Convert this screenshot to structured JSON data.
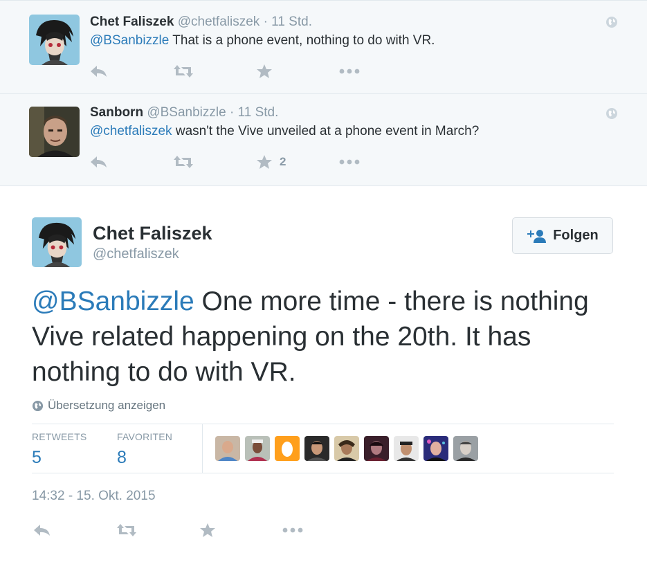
{
  "replies": [
    {
      "name": "Chet Faliszek",
      "handle": "@chetfaliszek",
      "separator": "·",
      "time": "11 Std.",
      "mention": "@BSanbizzle",
      "text": " That is a  phone event, nothing to do with VR.",
      "fav_count": ""
    },
    {
      "name": "Sanborn",
      "handle": "@BSanbizzle",
      "separator": "·",
      "time": "11 Std.",
      "mention": "@chetfaliszek",
      "text": " wasn't the Vive unveiled at a phone event in March?",
      "fav_count": "2"
    }
  ],
  "main": {
    "name": "Chet Faliszek",
    "handle": "@chetfaliszek",
    "follow_label": "Folgen",
    "mention": "@BSanbizzle",
    "text": " One more time - there is nothing Vive related happening on the 20th. It has nothing to do with VR.",
    "translate_label": "Übersetzung anzeigen",
    "retweets_label": "RETWEETS",
    "retweets_count": "5",
    "favorites_label": "FAVORITEN",
    "favorites_count": "8",
    "timestamp": "14:32 - 15. Okt. 2015"
  },
  "favoriters": [
    "favoriter-1",
    "favoriter-2",
    "favoriter-3",
    "favoriter-4",
    "favoriter-5",
    "favoriter-6",
    "favoriter-7",
    "favoriter-8",
    "favoriter-9"
  ],
  "colors": {
    "link": "#2b7bb9",
    "muted": "#8899a6",
    "icon": "#b1bbc3",
    "reply_bg": "#f5f8fa",
    "text": "#292f33"
  },
  "icons": [
    "reply-icon",
    "retweet-icon",
    "favorite-icon",
    "more-icon",
    "globe-icon",
    "follow-user-icon"
  ]
}
